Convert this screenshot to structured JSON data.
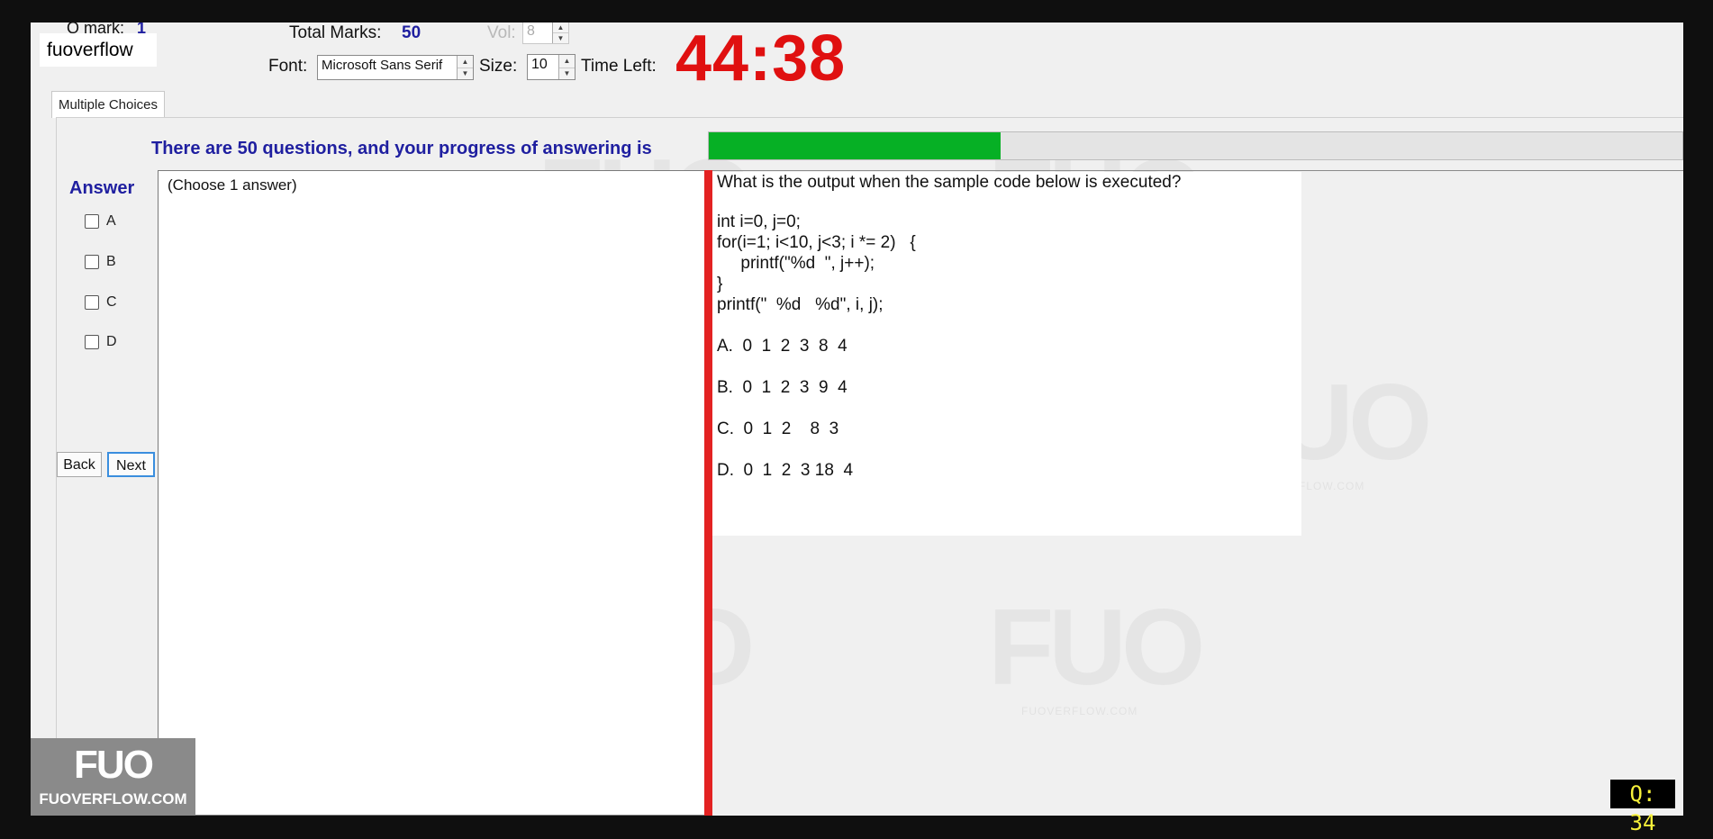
{
  "header": {
    "qmark_label": "Q mark:",
    "qmark_value": "1",
    "total_marks_label": "Total Marks:",
    "total_marks_value": "50",
    "vol_label": "Vol:",
    "vol_value": "8",
    "font_label": "Font:",
    "font_value": "Microsoft Sans Serif",
    "size_label": "Size:",
    "size_value": "10",
    "time_left_label": "Time Left:",
    "timer": "44:38"
  },
  "brand_overlay": "fuoverflow",
  "tabs": [
    {
      "label": "Multiple Choices"
    }
  ],
  "progress": {
    "label": "There are 50 questions, and your progress of answering is",
    "fraction": 0.3
  },
  "answer": {
    "title": "Answer",
    "options": [
      "A",
      "B",
      "C",
      "D"
    ],
    "choose_hint": "(Choose 1 answer)"
  },
  "nav": {
    "back_label": "Back",
    "next_label": "Next"
  },
  "question": {
    "lines": [
      "What is the output when the sample code below is executed?",
      "int i=0, j=0;",
      "for(i=1; i<10, j<3; i *= 2)   {",
      "     printf(\"%d  \", j++);",
      "}",
      "printf(\"  %d   %d\", i, j);",
      "A.  0  1  2  3  8  4",
      "B.  0  1  2  3  9  4",
      "C.  0  1  2    8  3",
      "D.  0  1  2  3 18  4"
    ]
  },
  "watermark": {
    "logo_text": "FUO",
    "site_text": "FUOVERFLOW.COM"
  },
  "corner_logo": {
    "big": "FUO",
    "small": "FUOVERFLOW.COM"
  },
  "question_counter": "Q: 34",
  "colors": {
    "timer": "#e01010",
    "progress_fill": "#06b025",
    "divider": "#e32222",
    "label_blue": "#1f1fa0"
  }
}
